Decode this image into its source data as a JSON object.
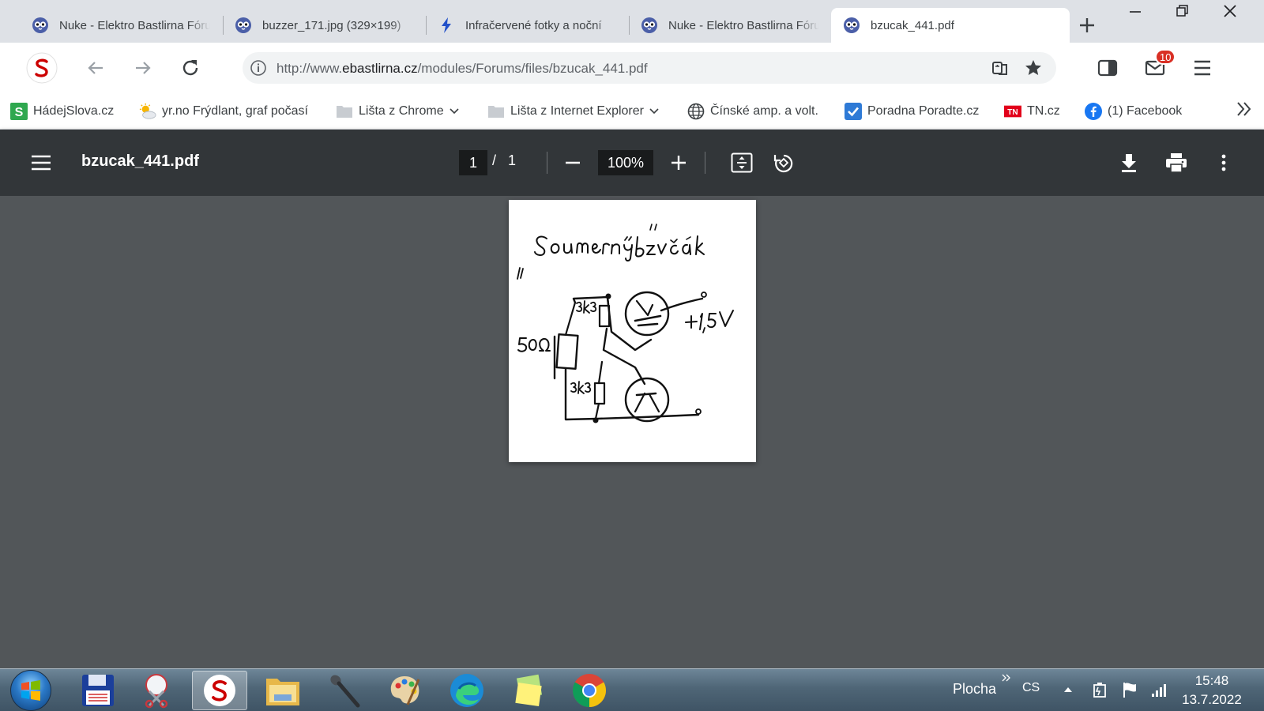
{
  "browser": {
    "tabs": [
      {
        "title": "Nuke - Elektro Bastlirna Fórum",
        "favicon": "owl-site-icon",
        "active": false
      },
      {
        "title": "buzzer_171.jpg (329×199)",
        "favicon": "owl-site-icon",
        "active": false
      },
      {
        "title": "Infračervené fotky a noční",
        "favicon": "lightning-icon",
        "active": false
      },
      {
        "title": "Nuke - Elektro Bastlirna Fórum",
        "favicon": "owl-site-icon",
        "active": false
      },
      {
        "title": "bzucak_441.pdf",
        "favicon": "owl-site-icon",
        "active": true
      }
    ],
    "url_prefix": "http://www.",
    "url_host": "ebastlirna.cz",
    "url_path": "/modules/Forums/files/bzucak_441.pdf",
    "mail_badge": "10",
    "colors": {
      "tabstrip": "#dee1e6",
      "toolbar": "#ffffff",
      "badge": "#d93025"
    }
  },
  "bookmarks": [
    {
      "label": "HádejSlova.cz",
      "icon": "green-s-icon"
    },
    {
      "label": "yr.no Frýdlant, graf počasí",
      "icon": "sun-cloud-icon"
    },
    {
      "label": "Lišta z Chrome",
      "icon": "folder-icon",
      "dropdown": true
    },
    {
      "label": "Lišta z Internet Explorer",
      "icon": "folder-icon",
      "dropdown": true
    },
    {
      "label": "Čínské amp. a volt.",
      "icon": "globe-icon"
    },
    {
      "label": "Poradna Poradte.cz",
      "icon": "checkbox-icon"
    },
    {
      "label": "TN.cz",
      "icon": "tn-logo-icon"
    },
    {
      "label": "(1) Facebook",
      "icon": "facebook-icon"
    }
  ],
  "pdf": {
    "filename": "bzucak_441.pdf",
    "current_page": "1",
    "page_separator": "/",
    "total_pages": "1",
    "zoom": "100%",
    "colors": {
      "toolbar": "#323639",
      "background": "#525659"
    }
  },
  "taskbar": {
    "tray_label": "Plocha",
    "language": "CS",
    "time": "15:48",
    "date": "13.7.2022"
  }
}
